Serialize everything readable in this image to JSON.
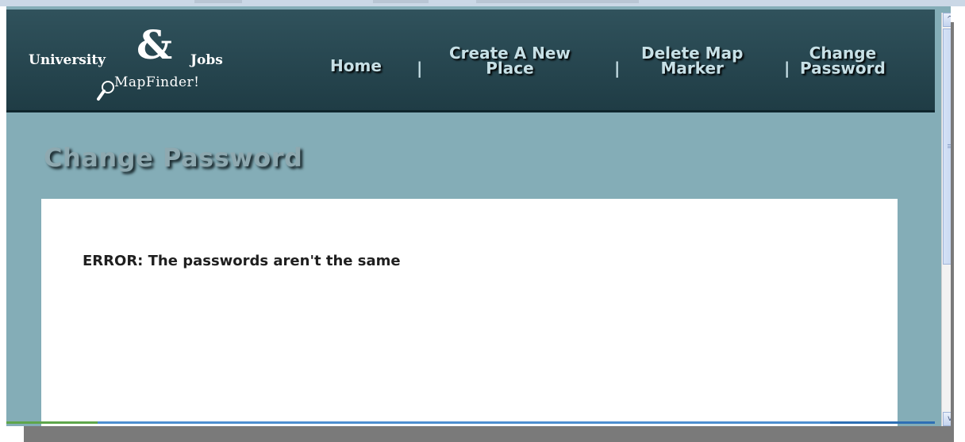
{
  "logo": {
    "word1": "University",
    "ampersand": "&",
    "word2": "Jobs",
    "subtitle": "MapFinder!",
    "icon": "magnifier-icon"
  },
  "nav": {
    "home": "Home",
    "create_line1": "Create A New",
    "create_line2": "Place",
    "delete_line1": "Delete Map",
    "delete_line2": "Marker",
    "change_line1": "Change",
    "change_line2": "Password",
    "separator": "|"
  },
  "page": {
    "title": "Change Password",
    "error_message": "ERROR: The passwords aren't the same"
  },
  "scrollbar": {
    "up_arrow": "^",
    "down_arrow": "v"
  },
  "colors": {
    "header": "#274650",
    "background": "#84adb7",
    "nav_text": "#c7e0e6",
    "content_bg": "#ffffff"
  }
}
